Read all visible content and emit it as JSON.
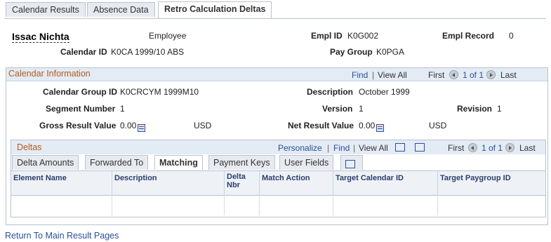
{
  "tabs": [
    {
      "label": "Calendar Results",
      "underline": "C",
      "rest": "alendar Results"
    },
    {
      "label": "Absence Data",
      "underline": "A",
      "rest": "bsence Data"
    },
    {
      "label": "Retro Calculation Deltas"
    }
  ],
  "header": {
    "name": "Issac Nichta",
    "employee_label": "Employee",
    "empl_id_label": "Empl ID",
    "empl_id": "K0G002",
    "empl_record_label": "Empl Record",
    "empl_record": "0",
    "calendar_id_label": "Calendar ID",
    "calendar_id": "K0CA 1999/10 ABS",
    "pay_group_label": "Pay Group",
    "pay_group": "K0PGA"
  },
  "calendar_info": {
    "title": "Calendar Information",
    "find": "Find",
    "view_all": "View All",
    "first": "First",
    "range": "1 of 1",
    "last": "Last",
    "fields": {
      "calendar_group_id_label": "Calendar Group ID",
      "calendar_group_id": "K0CRCYM 1999M10",
      "description_label": "Description",
      "description": "October 1999",
      "segment_number_label": "Segment Number",
      "segment_number": "1",
      "version_label": "Version",
      "version": "1",
      "revision_label": "Revision",
      "revision": "1",
      "gross_result_label": "Gross Result Value",
      "gross_result": "0.00",
      "gross_currency": "USD",
      "net_result_label": "Net Result Value",
      "net_result": "0.00",
      "net_currency": "USD"
    }
  },
  "deltas": {
    "title": "Deltas",
    "personalize": "Personalize",
    "find": "Find",
    "view_all": "View All",
    "first": "First",
    "range": "1 of 1",
    "last": "Last",
    "tabs": [
      "Delta Amounts",
      "Forwarded To",
      "Matching",
      "Payment Keys",
      "User Fields"
    ],
    "columns": [
      "Element Name",
      "Description",
      "Delta Nbr",
      "Match Action",
      "Target Calendar ID",
      "Target Paygroup ID"
    ]
  },
  "footer": {
    "return_link": "Return To Main Result Pages"
  }
}
